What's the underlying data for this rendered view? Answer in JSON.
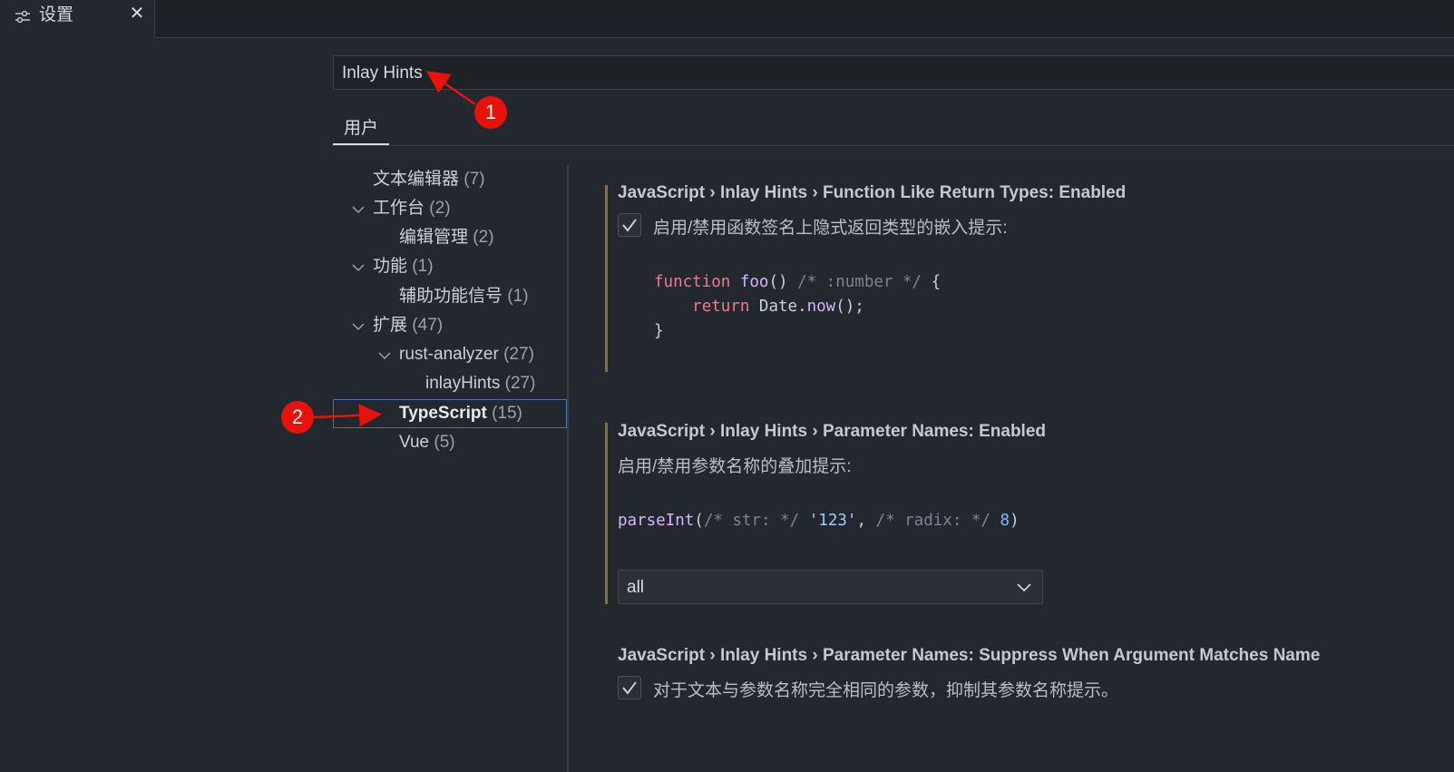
{
  "tab": {
    "title": "设置",
    "close_glyph": "✕"
  },
  "search": {
    "value": "Inlay Hints"
  },
  "scope": {
    "label": "用户"
  },
  "toc": {
    "items": [
      {
        "label": "文本编辑器",
        "count": "(7)"
      },
      {
        "label": "工作台",
        "count": "(2)"
      },
      {
        "label": "编辑管理",
        "count": "(2)"
      },
      {
        "label": "功能",
        "count": "(1)"
      },
      {
        "label": "辅助功能信号",
        "count": "(1)"
      },
      {
        "label": "扩展",
        "count": "(47)"
      },
      {
        "label": "rust-analyzer",
        "count": "(27)"
      },
      {
        "label": "inlayHints",
        "count": "(27)"
      },
      {
        "label": "TypeScript",
        "count": "(15)"
      },
      {
        "label": "Vue",
        "count": "(5)"
      }
    ]
  },
  "settings": [
    {
      "title": "JavaScript › Inlay Hints › Function Like Return Types: Enabled",
      "description": "启用/禁用函数签名上隐式返回类型的嵌入提示:",
      "checked": true,
      "code": {
        "l1_kw": "function",
        "l1_fn": "foo",
        "l1_paren": "()",
        "l1_cm": "/* :number */",
        "l1_brace": "{",
        "l2_kw": "return",
        "l2_obj": "Date.",
        "l2_fn": "now",
        "l2_tail": "();",
        "l3": "}"
      }
    },
    {
      "title": "JavaScript › Inlay Hints › Parameter Names: Enabled",
      "description": "启用/禁用参数名称的叠加提示:",
      "code": {
        "fn": "parseInt",
        "open": "(",
        "cm1": "/* str: */",
        "str": "'123'",
        "comma": ",",
        "cm2": "/* radix: */",
        "num": "8",
        "close": ")"
      },
      "select_value": "all"
    },
    {
      "title": "JavaScript › Inlay Hints › Parameter Names: Suppress When Argument Matches Name",
      "description": "对于文本与参数名称完全相同的参数，抑制其参数名称提示。",
      "checked": true
    }
  ],
  "annotations": {
    "badge1": "1",
    "badge2": "2"
  },
  "colors": {
    "annotation": "#e8120c",
    "selection_border": "#4a6fb0",
    "modified_bar": "#8a6d3b"
  },
  "icons": {
    "tab": "settings-sliders-icon",
    "close": "close-icon",
    "chevron": "chevron-down-icon",
    "check": "checkmark-icon"
  }
}
